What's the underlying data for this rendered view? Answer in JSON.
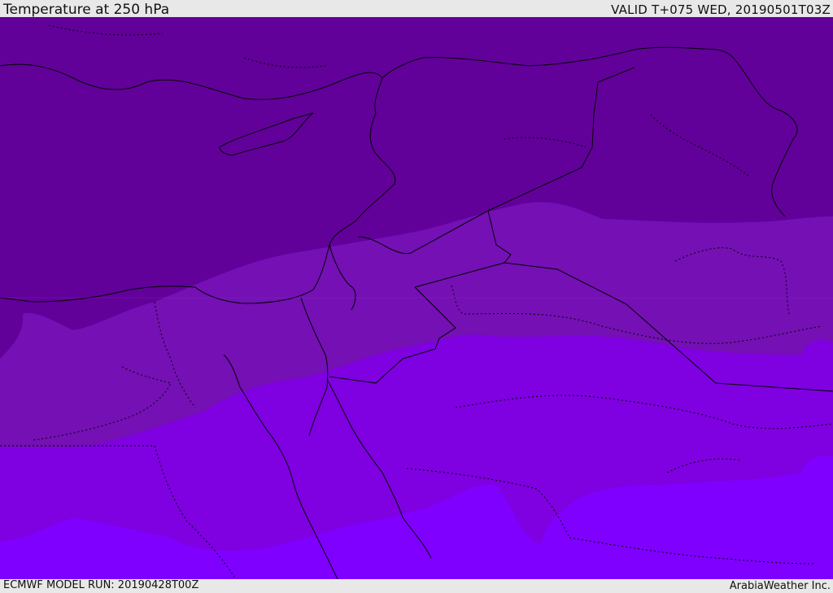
{
  "header": {
    "title": "Temperature at 250 hPa",
    "valid_time": "VALID T+075 WED, 20190501T03Z"
  },
  "footer": {
    "model_run": "ECMWF MODEL RUN: 20190428T00Z",
    "credit": "ArabiaWeather Inc."
  },
  "map": {
    "field_colors": [
      "#62009a",
      "#7410b4",
      "#7f00e0",
      "#7f00ff"
    ],
    "border_color": "#000000"
  }
}
